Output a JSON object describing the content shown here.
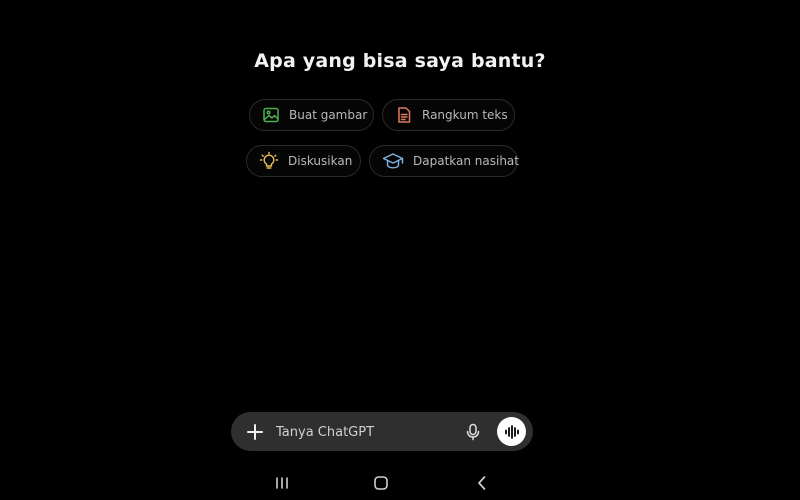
{
  "main": {
    "heading": "Apa yang bisa saya bantu?",
    "suggestions": [
      {
        "label": "Buat gambar",
        "icon": "image-icon",
        "color": "#4caf50"
      },
      {
        "label": "Rangkum teks",
        "icon": "document-icon",
        "color": "#e07a5f"
      },
      {
        "label": "Diskusikan",
        "icon": "lightbulb-icon",
        "color": "#e8c15a"
      },
      {
        "label": "Dapatkan nasihat",
        "icon": "graduation-cap-icon",
        "color": "#7fb3e0"
      }
    ]
  },
  "composer": {
    "placeholder": "Tanya ChatGPT",
    "plus_icon": "plus-icon",
    "mic_icon": "microphone-icon",
    "voice_icon": "voice-waveform-icon"
  },
  "navbar": {
    "recents_icon": "recents-icon",
    "home_icon": "home-icon",
    "back_icon": "back-icon"
  }
}
